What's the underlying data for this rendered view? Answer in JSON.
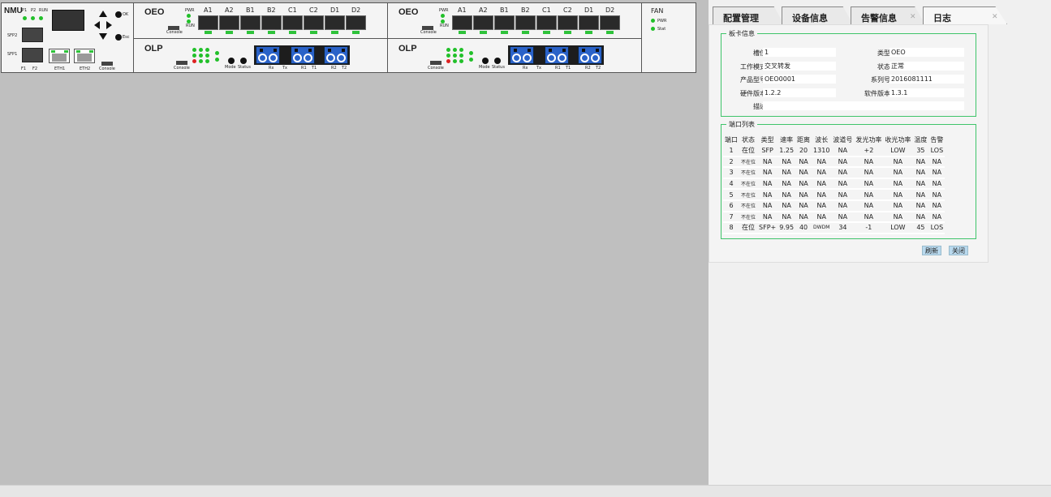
{
  "chassis": {
    "nmu": {
      "title": "NMU",
      "led_labels": [
        "P1",
        "P2",
        "RUN"
      ],
      "sfp2": "SFP2",
      "sfp1": "SFP1",
      "ok": "OK",
      "esc": "Esc",
      "f1": "F1",
      "f2": "F2",
      "eth1": "ETH1",
      "eth2": "ETH2",
      "console": "Console"
    },
    "oeo": {
      "title": "OEO",
      "pwr": "PWR",
      "run": "RUN",
      "console": "Console",
      "ports": [
        "A1",
        "A2",
        "B1",
        "B2",
        "C1",
        "C2",
        "D1",
        "D2"
      ]
    },
    "olp": {
      "title": "OLP",
      "console": "Console",
      "mode": "Mode",
      "status": "Status",
      "ports": [
        "Rx",
        "Tx",
        "R1",
        "T1",
        "R2",
        "T2"
      ]
    },
    "fan": {
      "title": "FAN",
      "pwr": "PWR",
      "stat": "Stat"
    }
  },
  "tabs": [
    {
      "label": "配置管理",
      "active": false,
      "closable": false
    },
    {
      "label": "设备信息",
      "active": false,
      "closable": false
    },
    {
      "label": "告警信息",
      "active": false,
      "closable": true
    },
    {
      "label": "日志",
      "active": true,
      "closable": true
    }
  ],
  "card_info": {
    "legend": "板卡信息",
    "slot_label": "槽位：",
    "slot": "1",
    "type_label": "类型：",
    "type": "OEO",
    "mode_label": "工作模式：",
    "mode": "交叉转发",
    "state_label": "状态：",
    "state": "正常",
    "model_label": "产品型号：",
    "model": "OEO0001",
    "serial_label": "系列号：",
    "serial": "2016081111",
    "hw_label": "硬件版本：",
    "hw": "1.2.2",
    "sw_label": "软件版本：",
    "sw": "1.3.1",
    "desc_label": "描述：",
    "desc": ""
  },
  "port_list": {
    "legend": "端口列表",
    "headers": [
      "端口",
      "状态",
      "类型",
      "速率",
      "距离",
      "波长",
      "波道号",
      "发光功率",
      "收光功率",
      "温度",
      "告警"
    ],
    "rows": [
      [
        "1",
        "在位",
        "SFP",
        "1.25",
        "20",
        "1310",
        "NA",
        "+2",
        "LOW",
        "35",
        "LOS"
      ],
      [
        "2",
        "不在位",
        "NA",
        "NA",
        "NA",
        "NA",
        "NA",
        "NA",
        "NA",
        "NA",
        "NA"
      ],
      [
        "3",
        "不在位",
        "NA",
        "NA",
        "NA",
        "NA",
        "NA",
        "NA",
        "NA",
        "NA",
        "NA"
      ],
      [
        "4",
        "不在位",
        "NA",
        "NA",
        "NA",
        "NA",
        "NA",
        "NA",
        "NA",
        "NA",
        "NA"
      ],
      [
        "5",
        "不在位",
        "NA",
        "NA",
        "NA",
        "NA",
        "NA",
        "NA",
        "NA",
        "NA",
        "NA"
      ],
      [
        "6",
        "不在位",
        "NA",
        "NA",
        "NA",
        "NA",
        "NA",
        "NA",
        "NA",
        "NA",
        "NA"
      ],
      [
        "7",
        "不在位",
        "NA",
        "NA",
        "NA",
        "NA",
        "NA",
        "NA",
        "NA",
        "NA",
        "NA"
      ],
      [
        "8",
        "在位",
        "SFP+",
        "9.95",
        "40",
        "DWDM",
        "34",
        "-1",
        "LOW",
        "45",
        "LOS"
      ]
    ]
  },
  "buttons": {
    "refresh": "刷新",
    "close": "关闭"
  },
  "colors": {
    "accent_green": "#3fc46a",
    "led_green": "#22c02a",
    "button_blue": "#b9d9ee",
    "olp_blue": "#2a62c8"
  }
}
